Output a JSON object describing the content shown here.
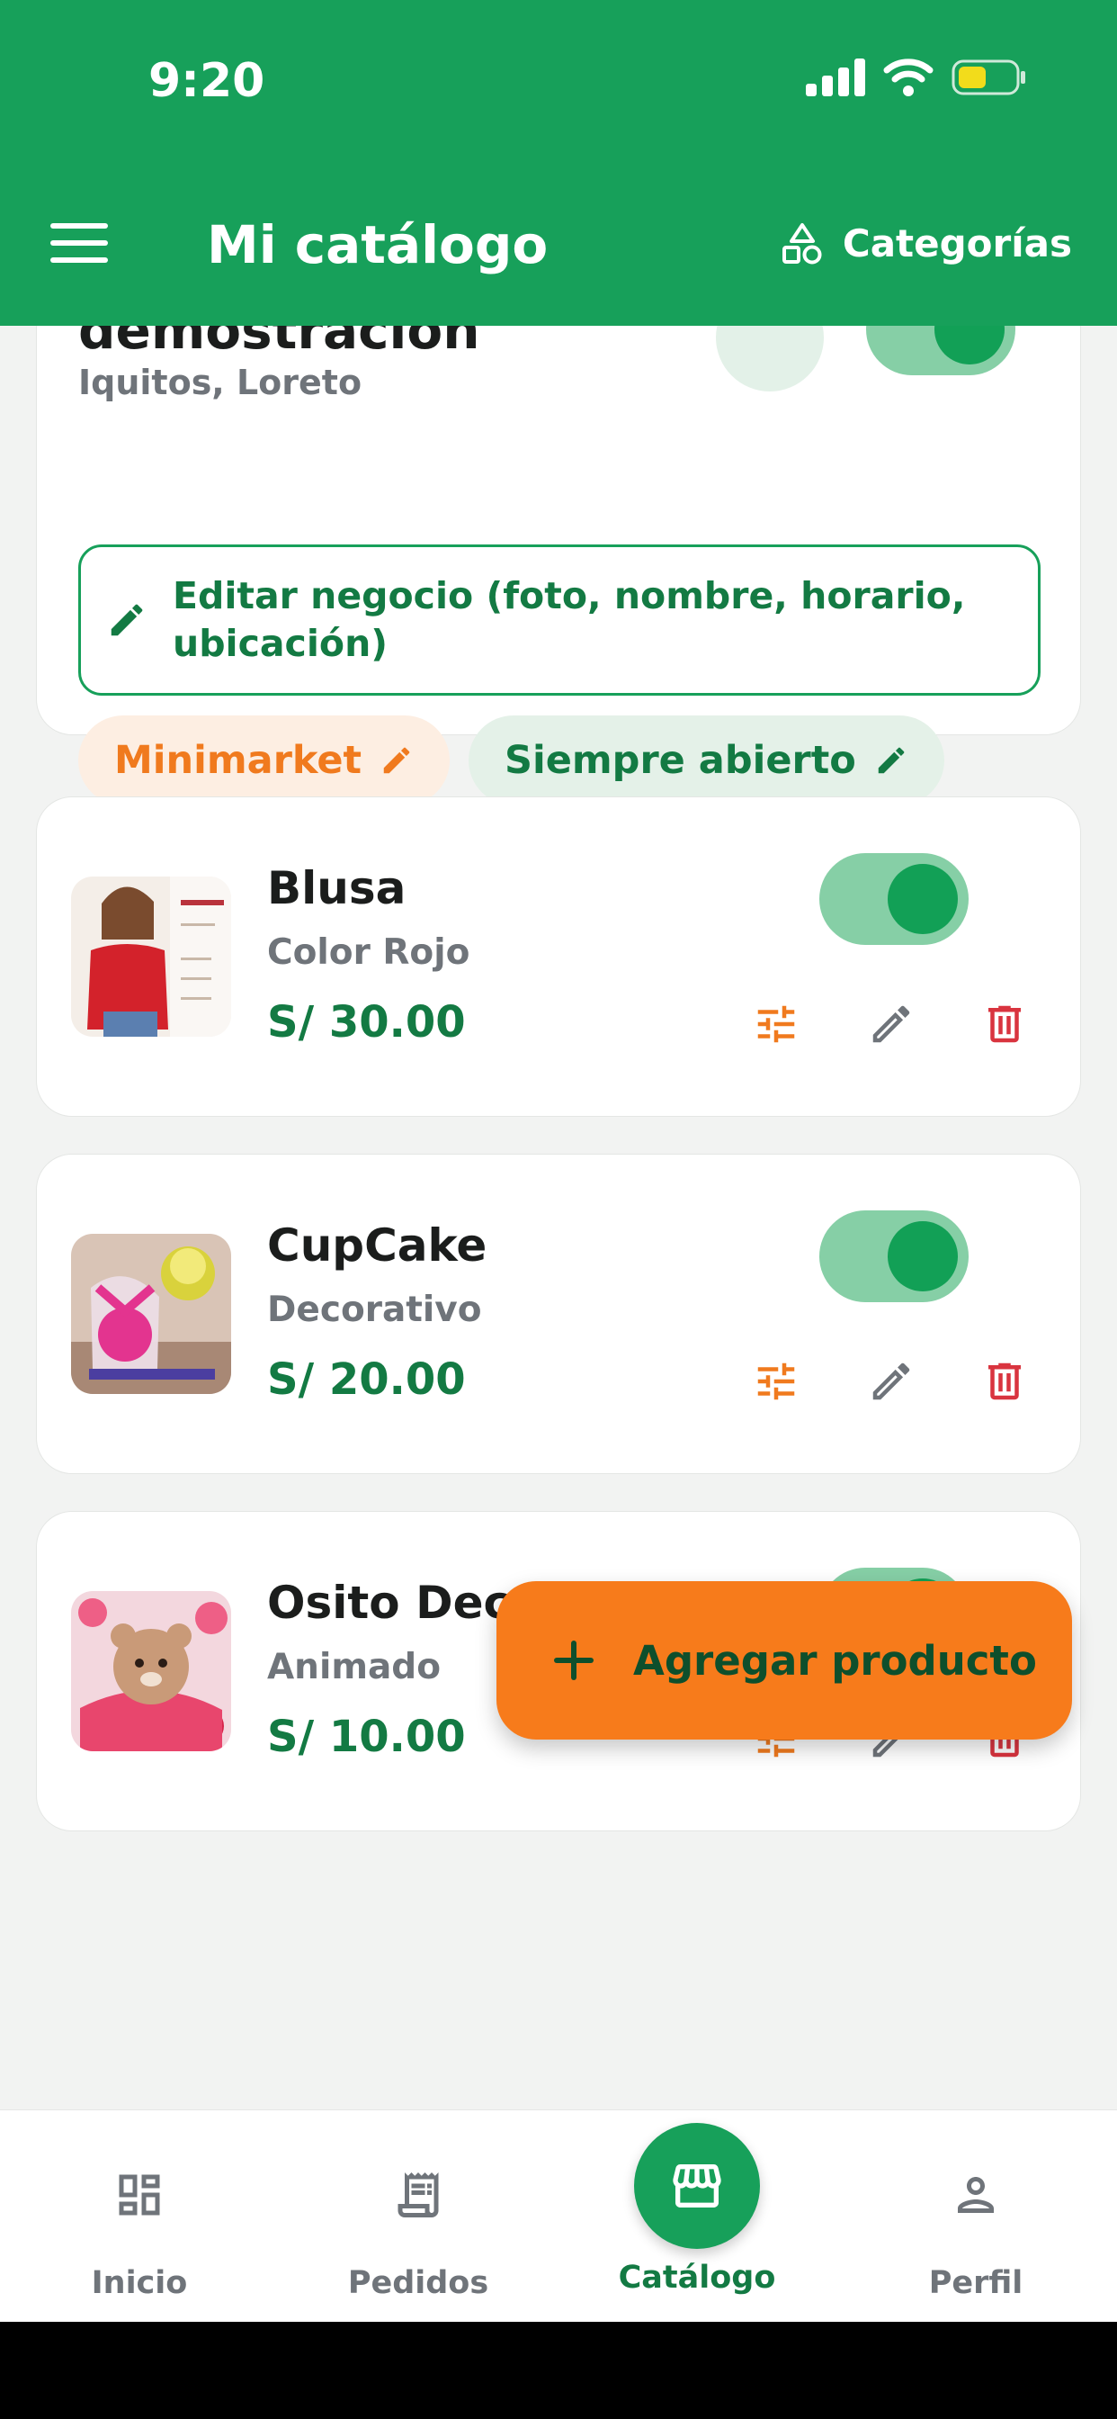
{
  "status_bar": {
    "time": "9:20"
  },
  "header": {
    "title": "Mi catálogo",
    "categories_label": "Categorías"
  },
  "business": {
    "name": "demostración",
    "location": "Iquitos, Loreto",
    "edit_label": "Editar negocio (foto, nombre, horario, ubicación)",
    "category_chip": "Minimarket",
    "hours_chip": "Siempre abierto"
  },
  "products": [
    {
      "name": "Blusa",
      "description": "Color Rojo",
      "price": "S/ 30.00",
      "active": true
    },
    {
      "name": "CupCake",
      "description": "Decorativo",
      "price": "S/ 20.00",
      "active": true
    },
    {
      "name": "Osito Decoración",
      "description": "Animado",
      "price": "S/ 10.00",
      "active": true
    }
  ],
  "fab": {
    "label": "Agregar producto"
  },
  "bottom_nav": [
    {
      "label": "Inicio",
      "icon": "dashboard-icon"
    },
    {
      "label": "Pedidos",
      "icon": "receipt-icon"
    },
    {
      "label": "Catálogo",
      "icon": "storefront-icon",
      "active": true
    },
    {
      "label": "Perfil",
      "icon": "person-icon"
    }
  ],
  "colors": {
    "primary": "#17a05a",
    "primary_dark": "#137a43",
    "accent": "#f77b1b",
    "danger": "#d9343f",
    "muted": "#6f747a"
  }
}
